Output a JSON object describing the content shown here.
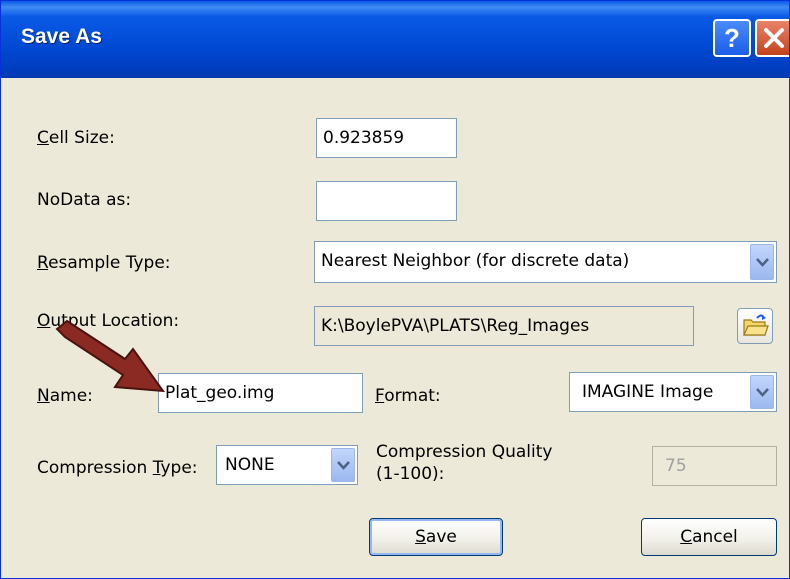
{
  "window": {
    "title": "Save As",
    "help_glyph": "?",
    "close_glyph": "×"
  },
  "form": {
    "cell_size": {
      "label_accel": "C",
      "label_rest": "ell Size:",
      "value": "0.923859"
    },
    "nodata": {
      "label": "NoData as:",
      "value": ""
    },
    "resample": {
      "label_accel": "R",
      "label_rest": "esample Type:",
      "value": "Nearest Neighbor (for discrete data)"
    },
    "output_location": {
      "label_accel": "O",
      "label_rest": "utput Location:",
      "value": "K:\\BoylePVA\\PLATS\\Reg_Images"
    },
    "name": {
      "label_accel": "N",
      "label_rest": "ame:",
      "value": "Plat_geo.img"
    },
    "format": {
      "label_accel": "F",
      "label_rest": "ormat:",
      "value": "IMAGINE Image"
    },
    "compression_type": {
      "label_pre": "Compression ",
      "label_accel": "T",
      "label_rest": "ype:",
      "value": "NONE"
    },
    "compression_quality": {
      "label_line1": "Compression Quality",
      "label_line2": "(1-100):",
      "value": "75"
    }
  },
  "buttons": {
    "save": {
      "accel": "S",
      "rest": "ave"
    },
    "cancel": {
      "accel": "C",
      "rest": "ancel"
    }
  },
  "icons": {
    "help": "question-icon",
    "close": "close-icon",
    "browse": "folder-open-icon",
    "dropdown": "chevron-down-icon",
    "annotation": "red-arrow-icon"
  },
  "colors": {
    "titlebar": "#0a5ae6",
    "dialog_bg": "#ece9d8",
    "arrow": "#8b2a22"
  }
}
